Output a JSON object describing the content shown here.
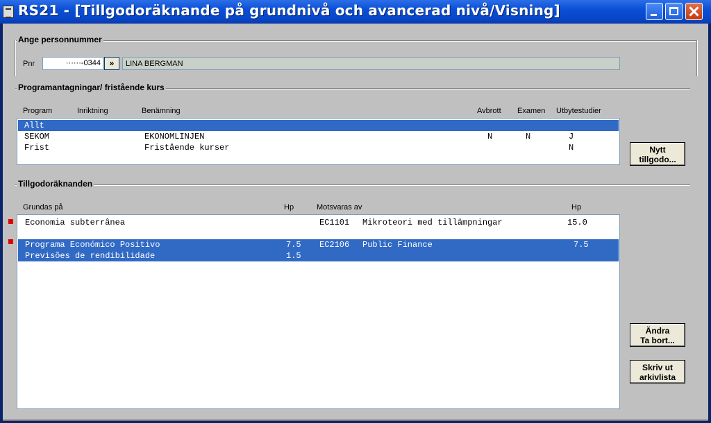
{
  "window": {
    "title": "RS21 - [Tillgodoräknande på grundnivå och avancerad nivå/Visning]"
  },
  "person_section": {
    "title": "Ange personnummer",
    "pnr_label": "Pnr",
    "pnr_value": "······-0344",
    "lookup_button": "»",
    "name": "LINA BERGMAN"
  },
  "program_section": {
    "title": "Programantagningar/ fristående kurs",
    "columns": [
      "Program",
      "Inriktning",
      "Benämning",
      "Avbrott",
      "Examen",
      "Utbytestudier"
    ],
    "rows": [
      {
        "program": "Allt",
        "inriktning": "",
        "benamning": "",
        "avbrott": "",
        "examen": "",
        "utbyte": "",
        "selected": true
      },
      {
        "program": "SEKOM",
        "inriktning": "",
        "benamning": "EKONOMLINJEN",
        "avbrott": "N",
        "examen": "N",
        "utbyte": "J",
        "selected": false
      },
      {
        "program": "Frist",
        "inriktning": "",
        "benamning": "Fristående kurser",
        "avbrott": "",
        "examen": "",
        "utbyte": "N",
        "selected": false
      }
    ],
    "new_button": [
      "Nytt",
      "tillgodo..."
    ]
  },
  "credit_section": {
    "title": "Tillgodoräknanden",
    "columns": [
      "Grundas på",
      "Hp",
      "Motsvaras av",
      "Hp"
    ],
    "rows": [
      {
        "grundas": "Economia subterrânea",
        "hp": "",
        "code": "EC1101",
        "course": "Mikroteori med tillämpningar",
        "hp2": "15.0",
        "selected": false
      },
      {
        "grundas": "Programa Económico Positivo",
        "hp": "7.5",
        "code": "EC2106",
        "course": "Public Finance",
        "hp2": "7.5",
        "selected": true
      },
      {
        "grundas": "Previsões de rendibilidade",
        "hp": "1.5",
        "code": "",
        "course": "",
        "hp2": "",
        "selected": true
      }
    ],
    "edit_button": [
      "Ändra",
      "Ta bort..."
    ],
    "print_button": [
      "Skriv ut",
      "arkivlista"
    ]
  },
  "colors": {
    "titlebar": "#0a4fd6",
    "selection": "#316ac5",
    "marker": "#e00000",
    "dialog": "#c0c0c0"
  }
}
